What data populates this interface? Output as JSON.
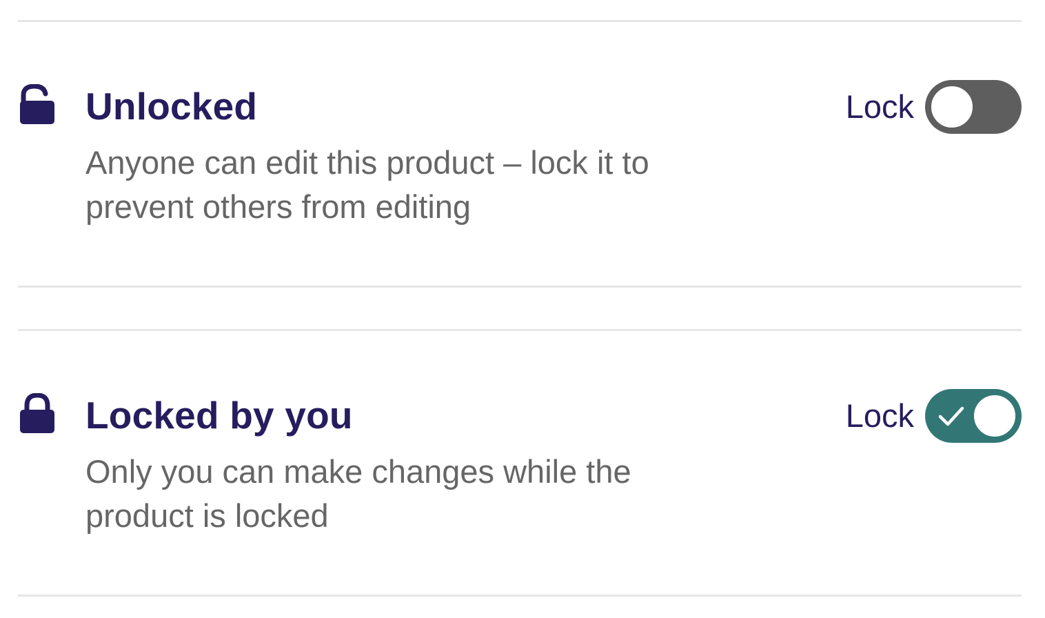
{
  "items": [
    {
      "title": "Unlocked",
      "description": "Anyone can edit this product – lock it to prevent others from editing",
      "toggle_label": "Lock",
      "toggle_on": false,
      "icon": "unlocked-padlock-icon"
    },
    {
      "title": "Locked by you",
      "description": "Only you can make changes while the product is locked",
      "toggle_label": "Lock",
      "toggle_on": true,
      "icon": "padlock-icon"
    }
  ],
  "colors": {
    "title": "#261d5e",
    "description": "#666666",
    "toggle_off": "#5e5e5e",
    "toggle_on": "#327776",
    "divider": "#e6e6e6"
  }
}
